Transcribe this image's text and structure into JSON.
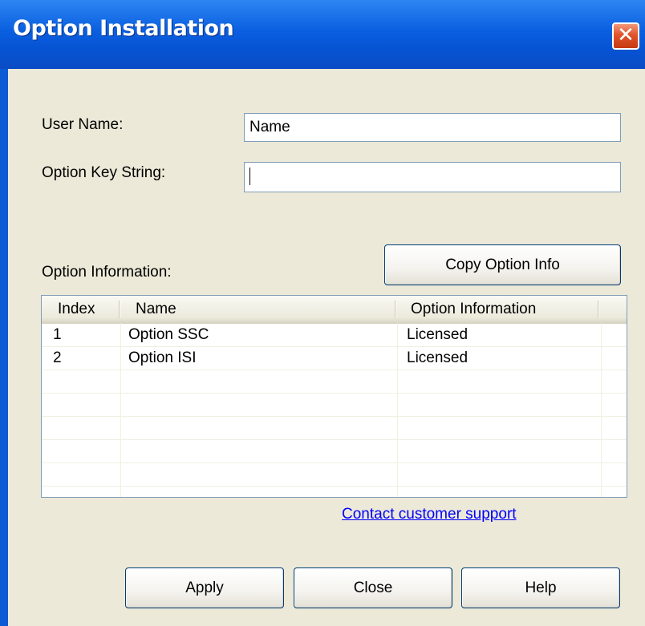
{
  "window": {
    "title": "Option Installation",
    "close_glyph": "✕"
  },
  "form": {
    "user_name_label": "User Name:",
    "user_name_value": "Name",
    "option_key_label": "Option Key String:",
    "option_key_value": ""
  },
  "option_info": {
    "label": "Option Information:",
    "copy_button": "Copy Option Info"
  },
  "table": {
    "columns": [
      "Index",
      "Name",
      "Option Information"
    ],
    "rows": [
      {
        "index": "1",
        "name": "Option SSC",
        "info": "Licensed"
      },
      {
        "index": "2",
        "name": "Option ISI",
        "info": "Licensed"
      }
    ]
  },
  "support_link": "Contact customer support",
  "buttons": {
    "apply": "Apply",
    "close": "Close",
    "help": "Help"
  },
  "colors": {
    "title_bar": "#0a5fe0",
    "dialog_bg": "#ece9d8",
    "close_button": "#e1542c",
    "link": "#0000ff"
  },
  "icons": {
    "close": "close-icon"
  }
}
